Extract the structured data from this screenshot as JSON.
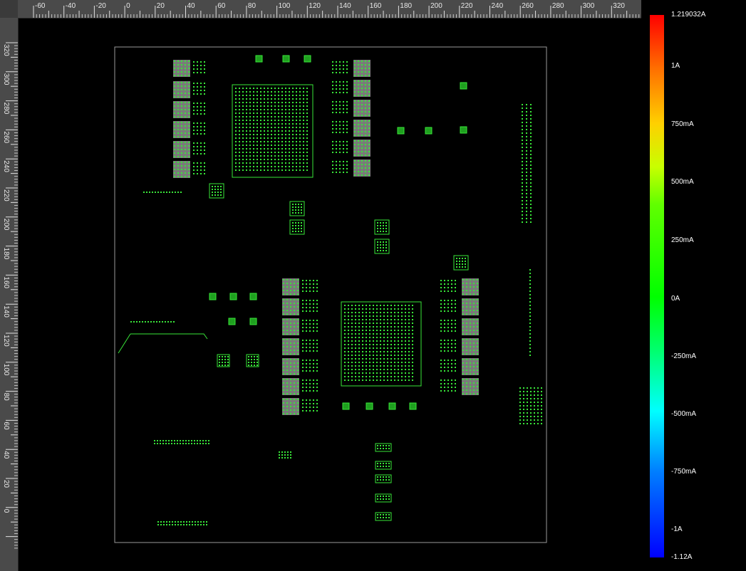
{
  "ruler_top": {
    "labels": [
      "-60",
      "-40",
      "-20",
      "0",
      "20",
      "40",
      "60",
      "80",
      "100",
      "120",
      "140",
      "160",
      "180",
      "200",
      "220",
      "240",
      "260",
      "280",
      "300",
      "320"
    ]
  },
  "ruler_left": {
    "labels": [
      "320",
      "300",
      "280",
      "260",
      "240",
      "220",
      "200",
      "180",
      "160",
      "140",
      "120",
      "100",
      "80",
      "60",
      "40",
      "20",
      "0"
    ]
  },
  "legend": {
    "title": "",
    "labels": [
      "1.219032A",
      "1A",
      "750mA",
      "500mA",
      "250mA",
      "0A",
      "-250mA",
      "-500mA",
      "-750mA",
      "-1A",
      "-1.12A"
    ],
    "max_color": "#ff0000",
    "min_color": "#0000ff"
  },
  "colors": {
    "background": "#000000",
    "ruler_bg": "#4a4a4a",
    "board_outline": "#9a9a9a",
    "trace_green": "#39e639",
    "pad_gray": "#7a7a7a"
  }
}
